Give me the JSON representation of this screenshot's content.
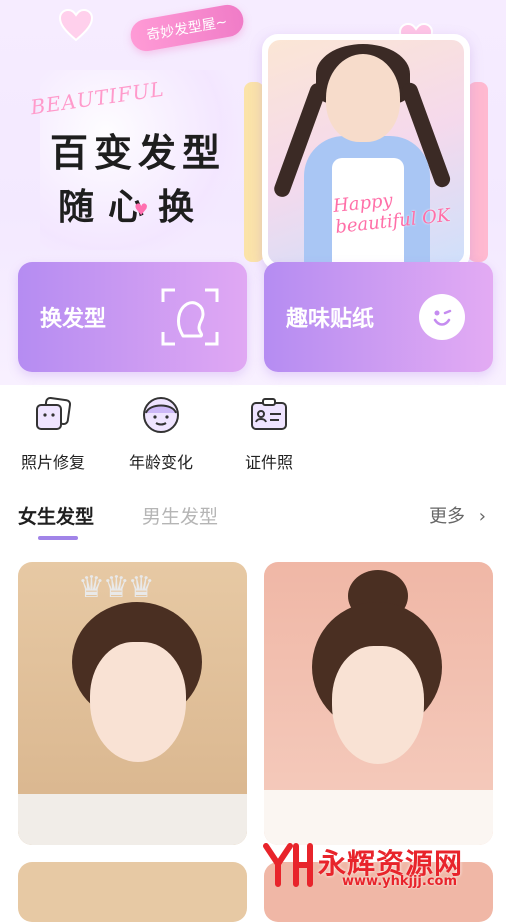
{
  "hero": {
    "bubble": "奇妙发型屋~",
    "beautiful": "BEAUTIFUL",
    "slogan_line1": "百变发型",
    "slogan_line2": "随心换",
    "photo_overlay_1": "Happy",
    "photo_overlay_2": "beautiful",
    "photo_overlay_3": "OK"
  },
  "features": [
    {
      "label": "换发型",
      "icon": "face-scan-icon"
    },
    {
      "label": "趣味贴纸",
      "icon": "wink-smiley-icon"
    }
  ],
  "tools": [
    {
      "label": "照片修复",
      "icon": "photo-stack-icon"
    },
    {
      "label": "年龄变化",
      "icon": "face-age-icon"
    },
    {
      "label": "证件照",
      "icon": "id-card-icon"
    }
  ],
  "tabs": {
    "active": "女生发型",
    "inactive": "男生发型",
    "more": "更多"
  },
  "watermark": {
    "logo": "YH",
    "title": "永辉资源网",
    "url": "www.yhkjjj.com"
  },
  "colors": {
    "accent": "#a184e8",
    "card_gradient_start": "#b58cf2",
    "card_gradient_end": "#e0a8f3",
    "bubble": "#f07cc7",
    "watermark": "#e8242b"
  }
}
